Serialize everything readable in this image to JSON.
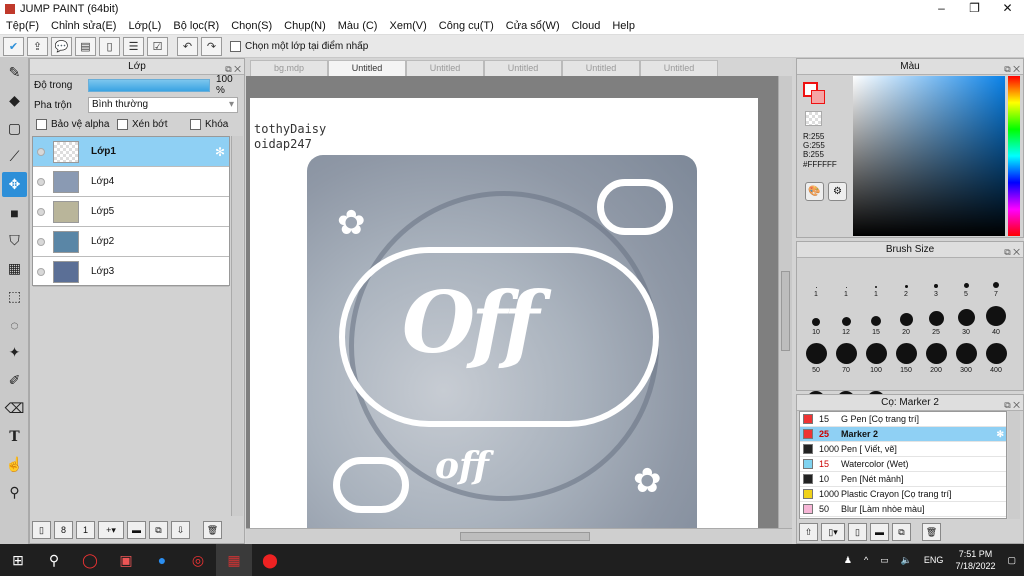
{
  "window": {
    "title": "JUMP PAINT (64bit)",
    "min": "–",
    "max": "❐",
    "close": "✕"
  },
  "menu": [
    "Tệp(F)",
    "Chỉnh sửa(E)",
    "Lớp(L)",
    "Bộ lọc(R)",
    "Chọn(S)",
    "Chụp(N)",
    "Màu (C)",
    "Xem(V)",
    "Công cụ(T)",
    "Cửa sổ(W)",
    "Cloud",
    "Help"
  ],
  "toolbar": {
    "select_layer_label": "Chọn một lớp tại điểm nhấp"
  },
  "layer_panel": {
    "title": "Lớp",
    "opacity_label": "Độ trong",
    "opacity_value": "100 %",
    "blend_label": "Pha trộn",
    "blend_value": "Bình thường",
    "protect_alpha": "Bảo vệ alpha",
    "clip": "Xén bớt",
    "lock": "Khóa",
    "layers": [
      {
        "name": "Lớp1",
        "thumb": "#e8ecf0"
      },
      {
        "name": "Lớp4",
        "thumb": "#8a9ab3"
      },
      {
        "name": "Lớp5",
        "thumb": "#b9b59a"
      },
      {
        "name": "Lớp2",
        "thumb": "#5a86a6"
      },
      {
        "name": "Lớp3",
        "thumb": "#5b6f96"
      }
    ]
  },
  "tabs": [
    "bg.mdp",
    "Untitled",
    "Untitled",
    "Untitled",
    "Untitled",
    "Untitled"
  ],
  "canvas": {
    "watermark_line1": "tothyDaisy",
    "watermark_line2": "oidap247",
    "art_text_big": "Off",
    "art_text_small": "off"
  },
  "color_panel": {
    "title": "Màu",
    "r": "R:255",
    "g": "G:255",
    "b": "B:255",
    "hex": "#FFFFFF"
  },
  "brush_panel": {
    "title": "Brush Size",
    "sizes": [
      "1",
      "1",
      "1",
      "2",
      "3",
      "5",
      "7",
      "10",
      "12",
      "15",
      "20",
      "25",
      "30",
      "40",
      "50",
      "70",
      "100",
      "150",
      "200",
      "300",
      "400",
      "",
      "",
      ""
    ]
  },
  "marker_panel": {
    "title": "Cọ: Marker 2",
    "items": [
      {
        "size": "15",
        "name": "G Pen [Cọ trang trí]",
        "color": "#e33"
      },
      {
        "size": "25",
        "name": "Marker 2",
        "color": "#e33"
      },
      {
        "size": "1000",
        "name": "Pen [ Viết, vẽ]",
        "color": "#222"
      },
      {
        "size": "15",
        "name": "Watercolor (Wet)",
        "color": "#7fd3f0"
      },
      {
        "size": "10",
        "name": "Pen [Nét mảnh]",
        "color": "#222"
      },
      {
        "size": "1000",
        "name": "Plastic Crayon [Cọ trang trí]",
        "color": "#f0d21a"
      },
      {
        "size": "50",
        "name": "Blur [Làm nhòe màu]",
        "color": "#f6b6d6"
      }
    ]
  },
  "taskbar": {
    "lang": "ENG",
    "time": "7:51 PM",
    "date": "7/18/2022"
  }
}
